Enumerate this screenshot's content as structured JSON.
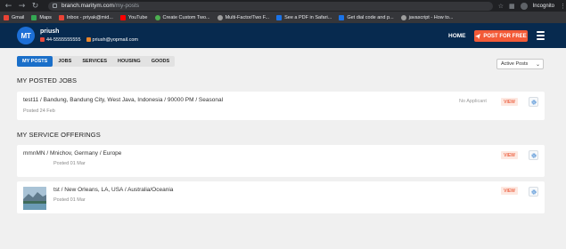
{
  "browser": {
    "url_host": "branch.maritym.com",
    "url_path": "/my-posts",
    "incognito_label": "Incognito",
    "bookmarks": [
      {
        "label": "Gmail",
        "color": "#ea4335"
      },
      {
        "label": "Maps",
        "color": "#34a853"
      },
      {
        "label": "Inbox - priyak@mid...",
        "color": "#ea4335"
      },
      {
        "label": "YouTube",
        "color": "#ff0000"
      },
      {
        "label": "Create Custom Two...",
        "color": "#4caf50"
      },
      {
        "label": "Multi-Factor/Two F...",
        "color": "#9e9e9e"
      },
      {
        "label": "See a PDF in Safari...",
        "color": "#1a73e8"
      },
      {
        "label": "Get dial code and p...",
        "color": "#1a73e8"
      },
      {
        "label": "javascript - How to...",
        "color": "#9e9e9e"
      }
    ]
  },
  "header": {
    "logo_text": "MT",
    "user_name": "priush",
    "phone": "44-5555555555",
    "email": "priush@yopmail.com",
    "home_label": "HOME",
    "post_button": "POST FOR FREE",
    "accent": "#f35a37",
    "bg": "#072a4f"
  },
  "tabs": [
    {
      "label": "MY POSTS",
      "active": true
    },
    {
      "label": "JOBS",
      "active": false
    },
    {
      "label": "SERVICES",
      "active": false
    },
    {
      "label": "HOUSING",
      "active": false
    },
    {
      "label": "GOODS",
      "active": false
    }
  ],
  "sort": {
    "selected": "Active Posts"
  },
  "jobs_section": {
    "title": "MY POSTED JOBS",
    "items": [
      {
        "title": "test11 / Bandung, Bandung City, West Java, Indonesia / 90000 PM / Seasonal",
        "date": "Posted 24 Feb",
        "applicants": "No Applicant",
        "view_label": "VIEW"
      }
    ]
  },
  "services_section": {
    "title": "MY SERVICE OFFERINGS",
    "items": [
      {
        "title": "mmnMN / Mnichov, Germany / Europe",
        "date": "Posted 01 Mar",
        "view_label": "VIEW"
      },
      {
        "title": "tst / New Orleans, LA, USA / Australia/Oceania",
        "date": "Posted 01 Mar",
        "view_label": "VIEW"
      }
    ]
  }
}
